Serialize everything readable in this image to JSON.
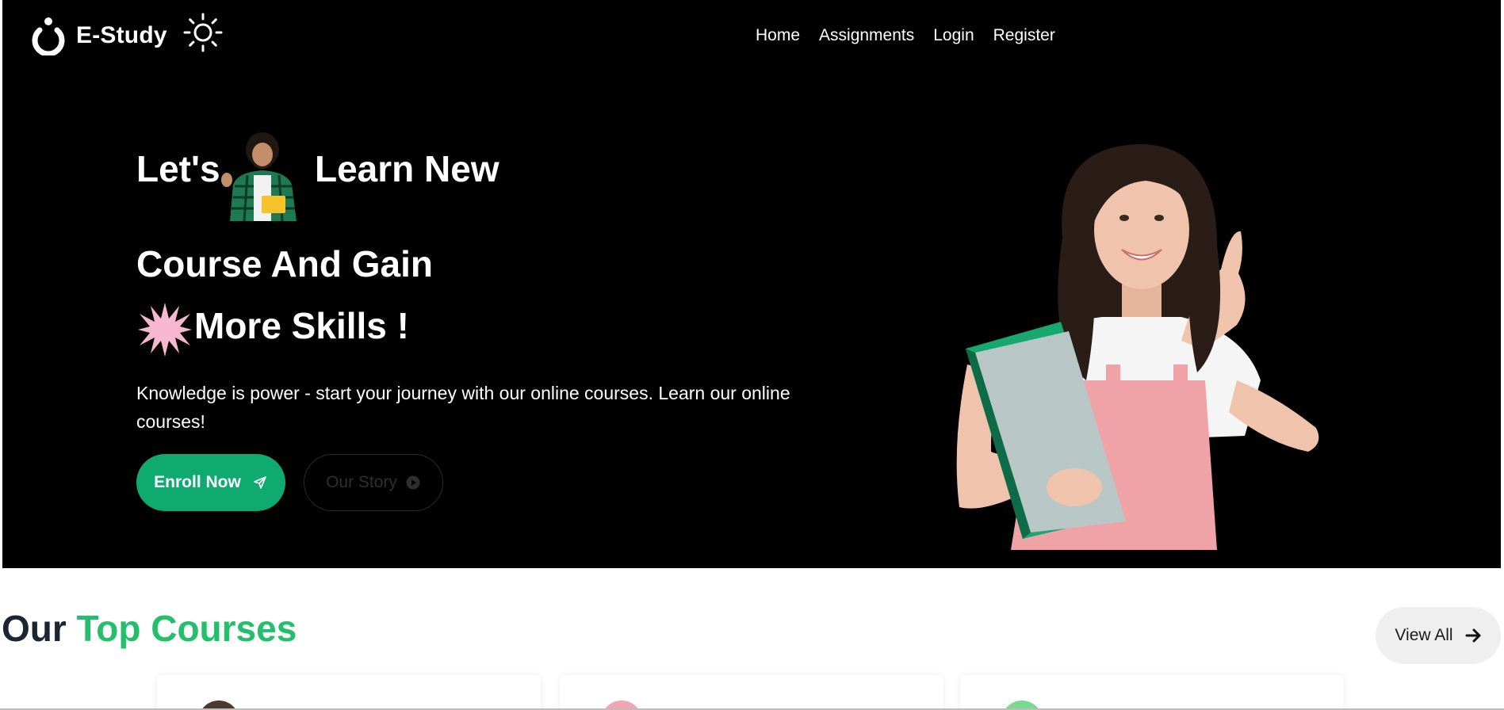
{
  "brand": {
    "name": "E-Study",
    "logo_icon": "power-ring-icon",
    "theme_icon": "sun-icon"
  },
  "nav": {
    "items": [
      {
        "label": "Home"
      },
      {
        "label": "Assignments"
      },
      {
        "label": "Login"
      },
      {
        "label": "Register"
      }
    ]
  },
  "hero": {
    "line1_a": "Let's",
    "line1_b": "Learn New",
    "line2": "Course And Gain",
    "line3": "More Skills !",
    "description": "Knowledge is power - start your journey with our online courses. Learn our online courses!",
    "enroll_label": "Enroll Now",
    "story_label": "Our Story",
    "accent_color": "#0eaa6f"
  },
  "courses": {
    "title_a": "Our",
    "title_b": "Top Courses",
    "view_all_label": "View All",
    "accent_color": "#23bf6b"
  }
}
